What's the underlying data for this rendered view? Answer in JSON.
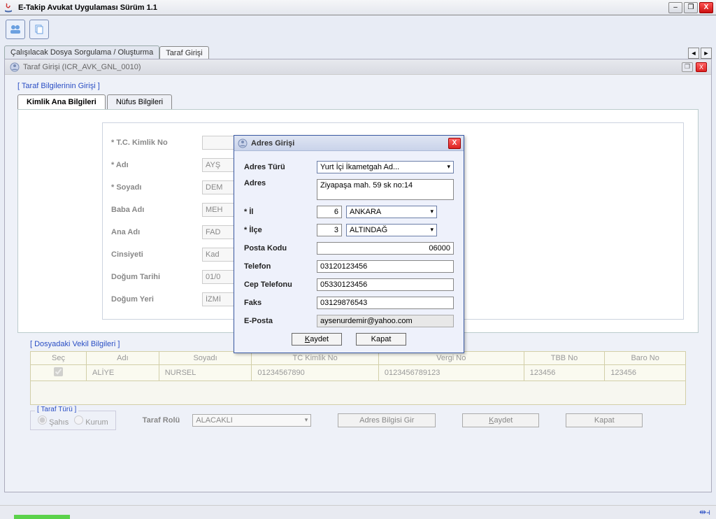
{
  "titlebar": {
    "title": "E-Takip Avukat Uygulaması Sürüm 1.1"
  },
  "main_tabs": {
    "tab1": "Çalışılacak Dosya Sorgulama / Oluşturma",
    "tab2": "Taraf Girişi"
  },
  "inner_header": {
    "title": "Taraf Girişi (ICR_AVK_GNL_0010)"
  },
  "section1": {
    "title": "[ Taraf Bilgilerinin Girişi ]"
  },
  "sub_tabs": {
    "tab1": "Kimlik Ana Bilgileri",
    "tab2": "Nüfus Bilgileri"
  },
  "form": {
    "tc_label": "* T.C. Kimlik No",
    "tc_val": "",
    "adi_label": "* Adı",
    "adi_val": "AYŞ",
    "soyadi_label": "* Soyadı",
    "soyadi_val": "DEM",
    "baba_label": "Baba Adı",
    "baba_val": "MEH",
    "ana_label": "Ana Adı",
    "ana_val": "FAD",
    "cins_label": "Cinsiyeti",
    "cins_val": "Kad",
    "dtarih_label": "Doğum Tarihi",
    "dtarih_val": "01/0",
    "dyeri_label": "Doğum Yeri",
    "dyeri_val": "İZMİ"
  },
  "vekil": {
    "title": "[ Dosyadaki Vekil Bilgileri ]",
    "cols": {
      "sec": "Seç",
      "adi": "Adı",
      "soyadi": "Soyadı",
      "tc": "TC Kimlik No",
      "vergi": "Vergi No",
      "tbb": "TBB No",
      "baro": "Baro No"
    },
    "row": {
      "adi": "ALİYE",
      "soyadi": "NURSEL",
      "tc": "01234567890",
      "vergi": "0123456789123",
      "tbb": "123456",
      "baro": "123456"
    }
  },
  "bottom": {
    "turu_legend": "[ Taraf Türü ]",
    "sahis": "Şahıs",
    "kurum": "Kurum",
    "rol_label": "Taraf Rolü",
    "rol_val": "ALACAKLI",
    "btn_adres": "Adres Bilgisi Gir",
    "btn_kaydet": "Kaydet",
    "btn_kapat": "Kapat"
  },
  "modal": {
    "title": "Adres Girişi",
    "adres_turu_label": "Adres Türü",
    "adres_turu_val": "Yurt İçi İkametgah Ad...",
    "adres_label": "Adres",
    "adres_val": "Ziyapaşa mah. 59 sk no:14",
    "il_label": "* İl",
    "il_code": "6",
    "il_val": "ANKARA",
    "ilce_label": "* İlçe",
    "ilce_code": "3",
    "ilce_val": "ALTINDAĞ",
    "pk_label": "Posta Kodu",
    "pk_val": "06000",
    "tel_label": "Telefon",
    "tel_val": "03120123456",
    "cep_label": "Cep Telefonu",
    "cep_val": "05330123456",
    "faks_label": "Faks",
    "faks_val": "03129876543",
    "eposta_label": "E-Posta",
    "eposta_val": "aysenurdemir@yahoo.com",
    "btn_kaydet": "aydet",
    "btn_kaydet_k": "K",
    "btn_kapat": "Kapat"
  }
}
